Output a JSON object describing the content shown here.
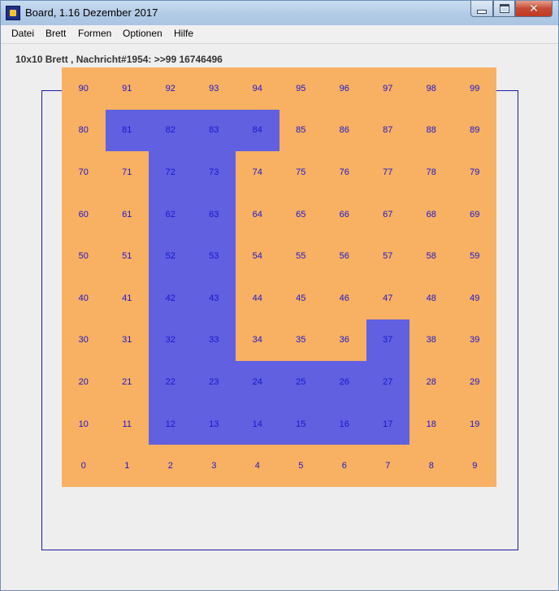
{
  "window": {
    "title": "Board, 1.16 Dezember 2017",
    "icon": "board-app-icon"
  },
  "menubar": {
    "items": [
      "Datei",
      "Brett",
      "Formen",
      "Optionen",
      "Hilfe"
    ]
  },
  "status_text": "10x10 Brett , Nachricht#1954: >>99 16746496",
  "board": {
    "rows": 10,
    "cols": 10,
    "colors": {
      "off": "#f8b062",
      "on": "#6060e0",
      "text": "#1818d0",
      "frame": "#1a1aa8"
    },
    "active_cells": [
      81,
      82,
      83,
      84,
      72,
      73,
      62,
      63,
      52,
      53,
      42,
      43,
      32,
      33,
      37,
      22,
      23,
      24,
      25,
      26,
      27,
      12,
      13,
      14,
      15,
      16,
      17
    ]
  }
}
